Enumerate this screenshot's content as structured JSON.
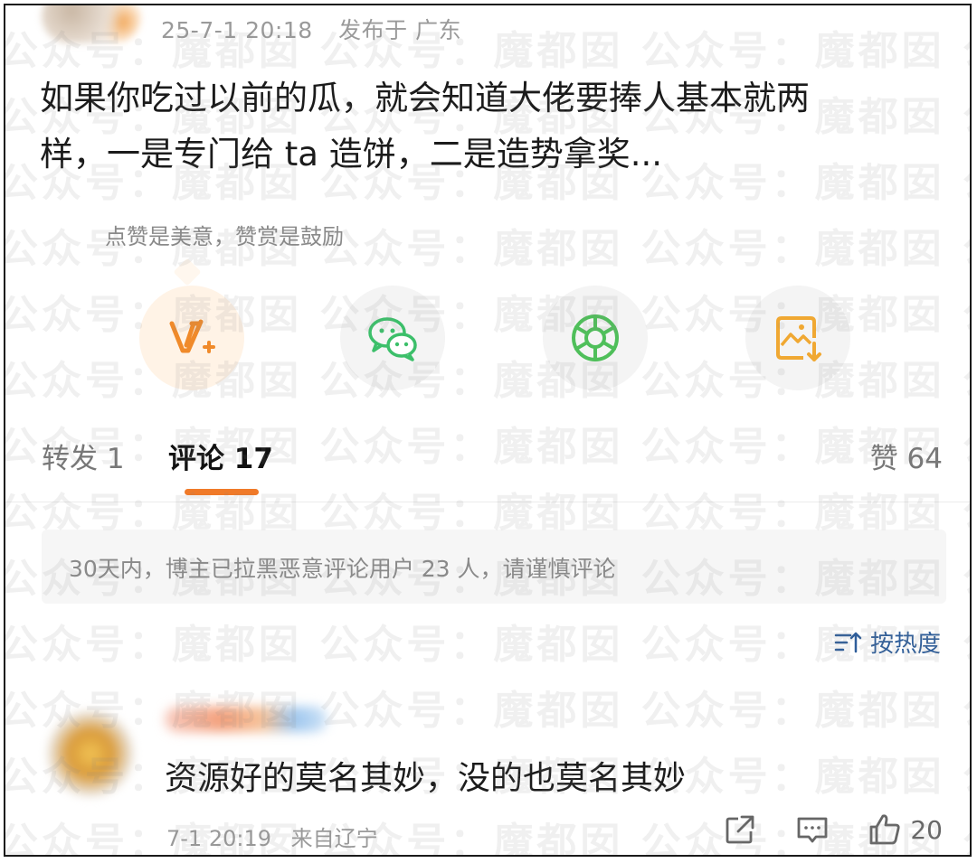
{
  "post": {
    "timestamp": "25-7-1 20:18",
    "location": "发布于 广东",
    "text_line1": "如果你吃过以前的瓜，就会知道大佬要捧人基本就两",
    "text_line2": "样，一是专门给 ta 造饼，二是造势拿奖..."
  },
  "tip": {
    "text": "点赞是美意，赞赏是鼓励"
  },
  "share": {
    "items": [
      {
        "name": "reward",
        "icon": "v-plus-icon",
        "color": "#f08a2a"
      },
      {
        "name": "wechat",
        "icon": "wechat-icon",
        "color": "#3cbf6a"
      },
      {
        "name": "moments",
        "icon": "moments-icon",
        "color": "#4fbf5a"
      },
      {
        "name": "save-image",
        "icon": "save-image-icon",
        "color": "#f0a832"
      }
    ]
  },
  "tabs": {
    "repost": "转发 1",
    "comment": "评论 17",
    "like": "赞 64"
  },
  "notice": {
    "text": "30天内，博主已拉黑恶意评论用户 23 人，请谨慎评论"
  },
  "sort": {
    "label": "按热度"
  },
  "comment": {
    "text": "资源好的莫名其妙，没的也莫名其妙",
    "time": "7-1 20:19",
    "location": "来自辽宁",
    "likes": "20"
  },
  "watermark": {
    "text": "公众号：魔都囡"
  },
  "colors": {
    "accent": "#f07a29",
    "link": "#2f5e9a"
  }
}
